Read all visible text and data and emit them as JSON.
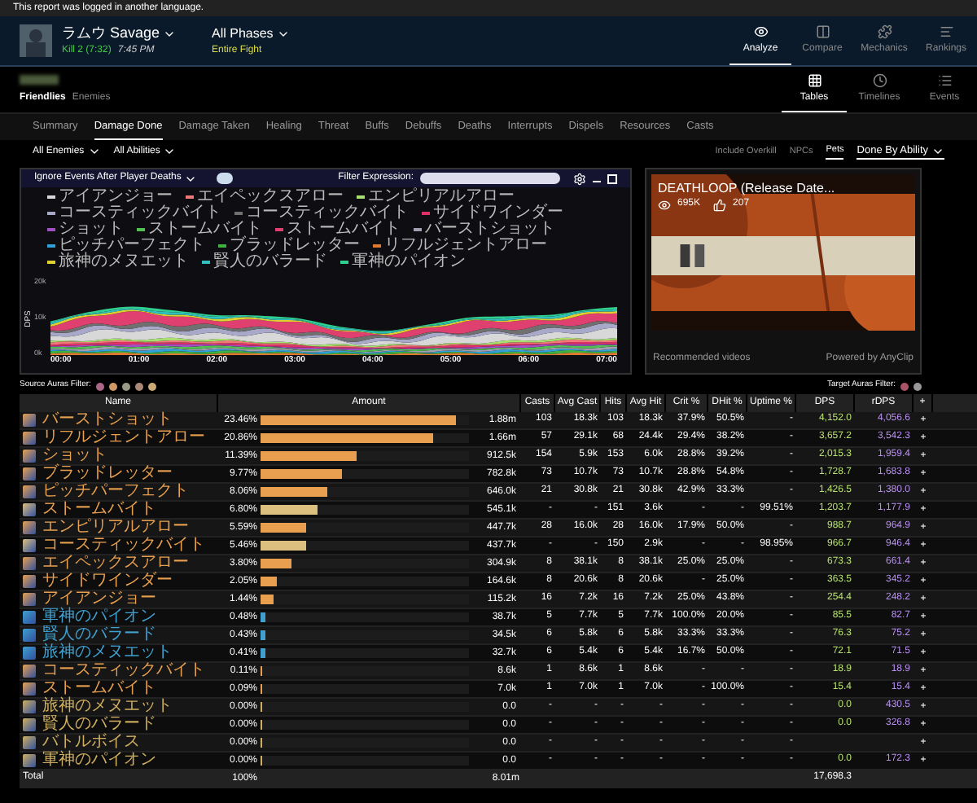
{
  "notice": "This report was logged in another language.",
  "header": {
    "title": "ラムウ Savage",
    "kill": "Kill 2 (7:32)",
    "time": "7:45 PM",
    "phase": "All Phases",
    "phase_detail": "Entire Fight",
    "nav": [
      {
        "label": "Analyze",
        "selected": true
      },
      {
        "label": "Compare",
        "selected": false
      },
      {
        "label": "Mechanics",
        "selected": false
      },
      {
        "label": "Rankings",
        "selected": false
      }
    ]
  },
  "subheader": {
    "views": [
      {
        "label": "Friendlies",
        "selected": true
      },
      {
        "label": "Enemies",
        "selected": false
      }
    ],
    "modes": [
      {
        "label": "Tables",
        "selected": true
      },
      {
        "label": "Timelines",
        "selected": false
      },
      {
        "label": "Events",
        "selected": false
      }
    ]
  },
  "tabs": [
    {
      "label": "Summary",
      "selected": false
    },
    {
      "label": "Damage Done",
      "selected": true
    },
    {
      "label": "Damage Taken",
      "selected": false
    },
    {
      "label": "Healing",
      "selected": false
    },
    {
      "label": "Threat",
      "selected": false
    },
    {
      "label": "Buffs",
      "selected": false
    },
    {
      "label": "Debuffs",
      "selected": false
    },
    {
      "label": "Deaths",
      "selected": false
    },
    {
      "label": "Interrupts",
      "selected": false
    },
    {
      "label": "Dispels",
      "selected": false
    },
    {
      "label": "Resources",
      "selected": false
    },
    {
      "label": "Casts",
      "selected": false
    }
  ],
  "filters": {
    "dropdowns": [
      "All Enemies",
      "All Abilities"
    ],
    "toggles": [
      {
        "label": "Include Overkill",
        "selected": false
      },
      {
        "label": "NPCs",
        "selected": false
      },
      {
        "label": "Pets",
        "selected": true
      }
    ],
    "grouping": "Done By Ability"
  },
  "chart": {
    "option": "Ignore Events After Player Deaths",
    "filter_label": "Filter Expression:",
    "legend": [
      {
        "label": "アイアンジョー",
        "color": "#d8d8d8"
      },
      {
        "label": "エイペックスアロー",
        "color": "#f07878"
      },
      {
        "label": "エンピリアルアロー",
        "color": "#a8e070"
      },
      {
        "label": "コースティックバイト",
        "color": "#a8a8c8"
      },
      {
        "label": "コースティックバイト",
        "color": "#707070"
      },
      {
        "label": "サイドワインダー",
        "color": "#e0306a"
      },
      {
        "label": "ショット",
        "color": "#a050c0"
      },
      {
        "label": "ストームバイト",
        "color": "#50c050"
      },
      {
        "label": "ストームバイト",
        "color": "#e04070"
      },
      {
        "label": "バーストショット",
        "color": "#a0a0b0"
      },
      {
        "label": "ピッチパーフェクト",
        "color": "#30a0d8"
      },
      {
        "label": "ブラッドレッター",
        "color": "#40b040"
      },
      {
        "label": "リフルジェントアロー",
        "color": "#e07830"
      },
      {
        "label": "旅神のメヌエット",
        "color": "#e0d030"
      },
      {
        "label": "賢人のバラード",
        "color": "#30c0c0"
      },
      {
        "label": "軍神のパイオン",
        "color": "#30d090"
      }
    ],
    "ylabel": "DPS",
    "yticks": [
      "20k",
      "10k",
      "0k"
    ],
    "xticks": [
      "00:00",
      "01:00",
      "02:00",
      "03:00",
      "04:00",
      "05:00",
      "06:00",
      "07:00"
    ]
  },
  "video": {
    "title": "DEATHLOOP (Release Date...",
    "views": "695K",
    "likes": "207",
    "footer": "Recommended videos",
    "credit": "Powered by AnyClip"
  },
  "auras": {
    "source_label": "Source Auras Filter:",
    "target_label": "Target Auras Filter:"
  },
  "table": {
    "columns": [
      "Name",
      "Amount",
      "Casts",
      "Avg Cast",
      "Hits",
      "Avg Hit",
      "Crit %",
      "DHit %",
      "Uptime %",
      "DPS",
      "rDPS",
      "+"
    ],
    "rows": [
      {
        "name": "バーストショット",
        "color": "#e8a050",
        "pct": "23.46%",
        "bar": {
          "level": 0.94,
          "color": "#e8a050"
        },
        "amount": "1.88m",
        "casts": "103",
        "avg_cast": "18.3k",
        "hits": "103",
        "avg_hit": "18.3k",
        "crit": "37.9%",
        "dhit": "50.5%",
        "uptime": "-",
        "dps": "4,152.0",
        "rdps": "4,056.6",
        "action": "+"
      },
      {
        "name": "リフルジェントアロー",
        "color": "#e8a050",
        "pct": "20.86%",
        "bar": {
          "level": 0.83,
          "color": "#e8a050"
        },
        "amount": "1.66m",
        "casts": "57",
        "avg_cast": "29.1k",
        "hits": "68",
        "avg_hit": "24.4k",
        "crit": "29.4%",
        "dhit": "38.2%",
        "uptime": "-",
        "dps": "3,657.2",
        "rdps": "3,542.3",
        "action": "+"
      },
      {
        "name": "ショット",
        "color": "#e8a050",
        "pct": "11.39%",
        "bar": {
          "level": 0.46,
          "color": "#e8a050"
        },
        "amount": "912.5k",
        "casts": "154",
        "avg_cast": "5.9k",
        "hits": "153",
        "avg_hit": "6.0k",
        "crit": "28.8%",
        "dhit": "39.2%",
        "uptime": "-",
        "dps": "2,015.3",
        "rdps": "1,959.4",
        "action": "+"
      },
      {
        "name": "ブラッドレッター",
        "color": "#e8a050",
        "pct": "9.77%",
        "bar": {
          "level": 0.39,
          "color": "#e8a050"
        },
        "amount": "782.8k",
        "casts": "73",
        "avg_cast": "10.7k",
        "hits": "73",
        "avg_hit": "10.7k",
        "crit": "28.8%",
        "dhit": "54.8%",
        "uptime": "-",
        "dps": "1,728.7",
        "rdps": "1,683.8",
        "action": "+"
      },
      {
        "name": "ピッチパーフェクト",
        "color": "#e8a050",
        "pct": "8.06%",
        "bar": {
          "level": 0.32,
          "color": "#e8a050"
        },
        "amount": "646.0k",
        "casts": "21",
        "avg_cast": "30.8k",
        "hits": "21",
        "avg_hit": "30.8k",
        "crit": "42.9%",
        "dhit": "33.3%",
        "uptime": "-",
        "dps": "1,426.5",
        "rdps": "1,380.0",
        "action": "+"
      },
      {
        "name": "ストームバイト",
        "color": "#e8a050",
        "pct": "6.80%",
        "bar": {
          "level": 0.27,
          "color": "#dcc080"
        },
        "amount": "545.1k",
        "casts": "-",
        "avg_cast": "-",
        "hits": "151",
        "avg_hit": "3.6k",
        "crit": "-",
        "dhit": "-",
        "uptime": "99.51%",
        "dps": "1,203.7",
        "rdps": "1,177.9",
        "action": "+"
      },
      {
        "name": "エンピリアルアロー",
        "color": "#e8a050",
        "pct": "5.59%",
        "bar": {
          "level": 0.22,
          "color": "#e8a050"
        },
        "amount": "447.7k",
        "casts": "28",
        "avg_cast": "16.0k",
        "hits": "28",
        "avg_hit": "16.0k",
        "crit": "17.9%",
        "dhit": "50.0%",
        "uptime": "-",
        "dps": "988.7",
        "rdps": "964.9",
        "action": "+"
      },
      {
        "name": "コースティックバイト",
        "color": "#e8a050",
        "pct": "5.46%",
        "bar": {
          "level": 0.22,
          "color": "#dcc080"
        },
        "amount": "437.7k",
        "casts": "-",
        "avg_cast": "-",
        "hits": "150",
        "avg_hit": "2.9k",
        "crit": "-",
        "dhit": "-",
        "uptime": "98.95%",
        "dps": "966.7",
        "rdps": "946.4",
        "action": "+"
      },
      {
        "name": "エイペックスアロー",
        "color": "#e8a050",
        "pct": "3.80%",
        "bar": {
          "level": 0.15,
          "color": "#e8a050"
        },
        "amount": "304.9k",
        "casts": "8",
        "avg_cast": "38.1k",
        "hits": "8",
        "avg_hit": "38.1k",
        "crit": "25.0%",
        "dhit": "25.0%",
        "uptime": "-",
        "dps": "673.3",
        "rdps": "661.4",
        "action": "+"
      },
      {
        "name": "サイドワインダー",
        "color": "#e8a050",
        "pct": "2.05%",
        "bar": {
          "level": 0.08,
          "color": "#e8a050"
        },
        "amount": "164.6k",
        "casts": "8",
        "avg_cast": "20.6k",
        "hits": "8",
        "avg_hit": "20.6k",
        "crit": "-",
        "dhit": "25.0%",
        "uptime": "-",
        "dps": "363.5",
        "rdps": "345.2",
        "action": "+"
      },
      {
        "name": "アイアンジョー",
        "color": "#e8a050",
        "pct": "1.44%",
        "bar": {
          "level": 0.06,
          "color": "#e8a050"
        },
        "amount": "115.2k",
        "casts": "16",
        "avg_cast": "7.2k",
        "hits": "16",
        "avg_hit": "7.2k",
        "crit": "25.0%",
        "dhit": "43.8%",
        "uptime": "-",
        "dps": "254.4",
        "rdps": "248.2",
        "action": "+"
      },
      {
        "name": "軍神のパイオン",
        "color": "#40a0d0",
        "pct": "0.48%",
        "bar": {
          "level": 0.02,
          "color": "#40a0d0"
        },
        "amount": "38.7k",
        "casts": "5",
        "avg_cast": "7.7k",
        "hits": "5",
        "avg_hit": "7.7k",
        "crit": "100.0%",
        "dhit": "20.0%",
        "uptime": "-",
        "dps": "85.5",
        "rdps": "82.7",
        "action": "+"
      },
      {
        "name": "賢人のバラード",
        "color": "#40a0d0",
        "pct": "0.43%",
        "bar": {
          "level": 0.02,
          "color": "#40a0d0"
        },
        "amount": "34.5k",
        "casts": "6",
        "avg_cast": "5.8k",
        "hits": "6",
        "avg_hit": "5.8k",
        "crit": "33.3%",
        "dhit": "33.3%",
        "uptime": "-",
        "dps": "76.3",
        "rdps": "75.2",
        "action": "+"
      },
      {
        "name": "旅神のメヌエット",
        "color": "#40a0d0",
        "pct": "0.41%",
        "bar": {
          "level": 0.02,
          "color": "#40a0d0"
        },
        "amount": "32.7k",
        "casts": "6",
        "avg_cast": "5.4k",
        "hits": "6",
        "avg_hit": "5.4k",
        "crit": "16.7%",
        "dhit": "50.0%",
        "uptime": "-",
        "dps": "72.1",
        "rdps": "71.5",
        "action": "+"
      },
      {
        "name": "コースティックバイト",
        "color": "#e8a050",
        "pct": "0.11%",
        "bar": {
          "level": 0.005,
          "color": "#e8a050"
        },
        "amount": "8.6k",
        "casts": "1",
        "avg_cast": "8.6k",
        "hits": "1",
        "avg_hit": "8.6k",
        "crit": "-",
        "dhit": "-",
        "uptime": "-",
        "dps": "18.9",
        "rdps": "18.9",
        "action": "+"
      },
      {
        "name": "ストームバイト",
        "color": "#e8a050",
        "pct": "0.09%",
        "bar": {
          "level": 0.004,
          "color": "#e8a050"
        },
        "amount": "7.0k",
        "casts": "1",
        "avg_cast": "7.0k",
        "hits": "1",
        "avg_hit": "7.0k",
        "crit": "-",
        "dhit": "100.0%",
        "uptime": "-",
        "dps": "15.4",
        "rdps": "15.4",
        "action": "+"
      },
      {
        "name": "旅神のメヌエット",
        "color": "#d0b060",
        "pct": "0.00%",
        "bar": {
          "level": 0.003,
          "color": "#d0b060"
        },
        "amount": "0.0",
        "casts": "-",
        "avg_cast": "-",
        "hits": "-",
        "avg_hit": "-",
        "crit": "-",
        "dhit": "-",
        "uptime": "-",
        "dps": "0.0",
        "rdps": "430.5",
        "action": "+"
      },
      {
        "name": "賢人のバラード",
        "color": "#d0b060",
        "pct": "0.00%",
        "bar": {
          "level": 0.003,
          "color": "#d0b060"
        },
        "amount": "0.0",
        "casts": "-",
        "avg_cast": "-",
        "hits": "-",
        "avg_hit": "-",
        "crit": "-",
        "dhit": "-",
        "uptime": "-",
        "dps": "0.0",
        "rdps": "326.8",
        "action": "+"
      },
      {
        "name": "バトルボイス",
        "color": "#d0b060",
        "pct": "0.00%",
        "bar": {
          "level": 0.003,
          "color": "#d0b060"
        },
        "amount": "0.0",
        "casts": "-",
        "avg_cast": "-",
        "hits": "-",
        "avg_hit": "-",
        "crit": "-",
        "dhit": "-",
        "uptime": "-",
        "action": "+"
      },
      {
        "name": "軍神のパイオン",
        "color": "#d0b060",
        "pct": "0.00%",
        "bar": {
          "level": 0.003,
          "color": "#d0b060"
        },
        "amount": "0.0",
        "casts": "-",
        "avg_cast": "-",
        "hits": "-",
        "avg_hit": "-",
        "crit": "-",
        "dhit": "-",
        "uptime": "-",
        "dps": "0.0",
        "rdps": "172.3",
        "action": "+"
      }
    ],
    "total": {
      "label": "Total",
      "pct": "100%",
      "amount": "8.01m",
      "dps": "17,698.3"
    }
  }
}
